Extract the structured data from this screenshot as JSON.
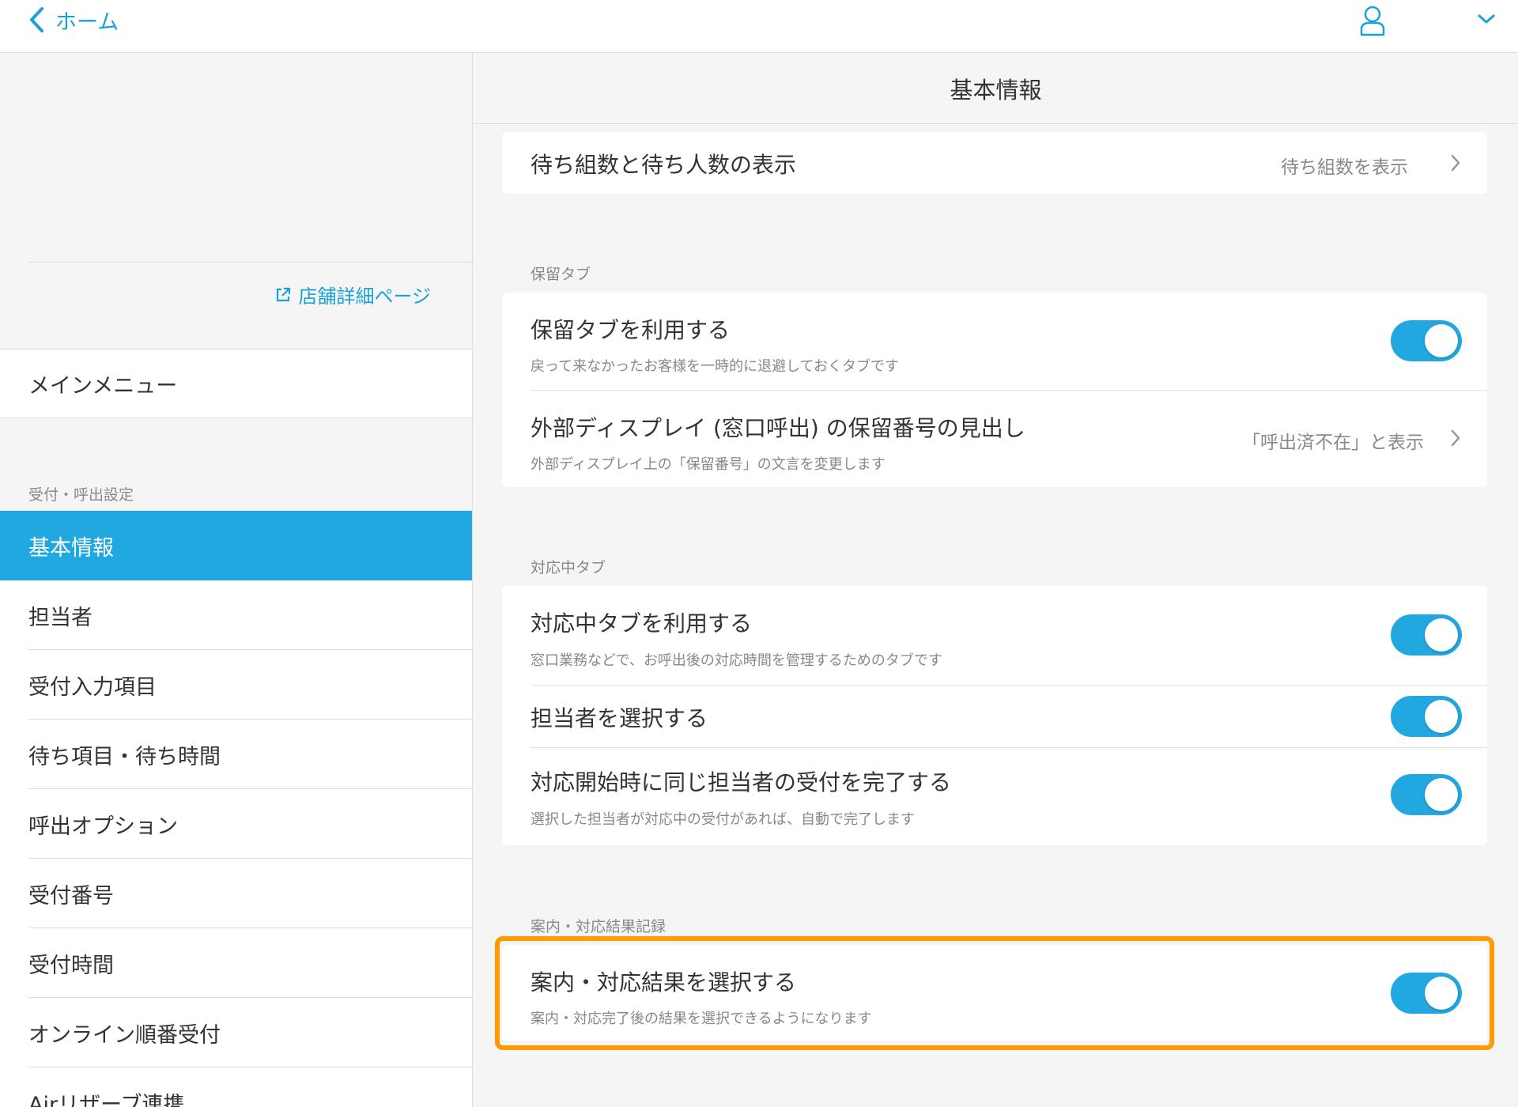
{
  "topbar": {
    "back_label": "ホーム"
  },
  "sidebar": {
    "store_link": "店舗詳細ページ",
    "main_menu": "メインメニュー",
    "section_label": "受付・呼出設定",
    "items": [
      {
        "label": "基本情報",
        "active": true
      },
      {
        "label": "担当者"
      },
      {
        "label": "受付入力項目"
      },
      {
        "label": "待ち項目・待ち時間"
      },
      {
        "label": "呼出オプション"
      },
      {
        "label": "受付番号"
      },
      {
        "label": "受付時間"
      },
      {
        "label": "オンライン順番受付"
      },
      {
        "label": "Airリザーブ連携"
      }
    ]
  },
  "main": {
    "title": "基本情報",
    "wait_display": {
      "title": "待ち組数と待ち人数の表示",
      "value": "待ち組数を表示"
    },
    "hold_tab": {
      "section": "保留タブ",
      "use": {
        "title": "保留タブを利用する",
        "subtitle": "戻って来なかったお客様を一時的に退避しておくタブです",
        "on": true
      },
      "heading": {
        "title": "外部ディスプレイ (窓口呼出) の保留番号の見出し",
        "subtitle": "外部ディスプレイ上の「保留番号」の文言を変更します",
        "value": "「呼出済不在」と表示"
      }
    },
    "active_tab": {
      "section": "対応中タブ",
      "use": {
        "title": "対応中タブを利用する",
        "subtitle": "窓口業務などで、お呼出後の対応時間を管理するためのタブです",
        "on": true
      },
      "select_staff": {
        "title": "担当者を選択する",
        "on": true
      },
      "complete_same": {
        "title": "対応開始時に同じ担当者の受付を完了する",
        "subtitle": "選択した担当者が対応中の受付があれば、自動で完了します",
        "on": true
      }
    },
    "result_record": {
      "section": "案内・対応結果記録",
      "select_result": {
        "title": "案内・対応結果を選択する",
        "subtitle": "案内・対応完了後の結果を選択できるようになります",
        "on": true
      }
    }
  },
  "colors": {
    "accent": "#21a8e0",
    "link": "#1ba1d8",
    "highlight": "#ff9a00"
  }
}
